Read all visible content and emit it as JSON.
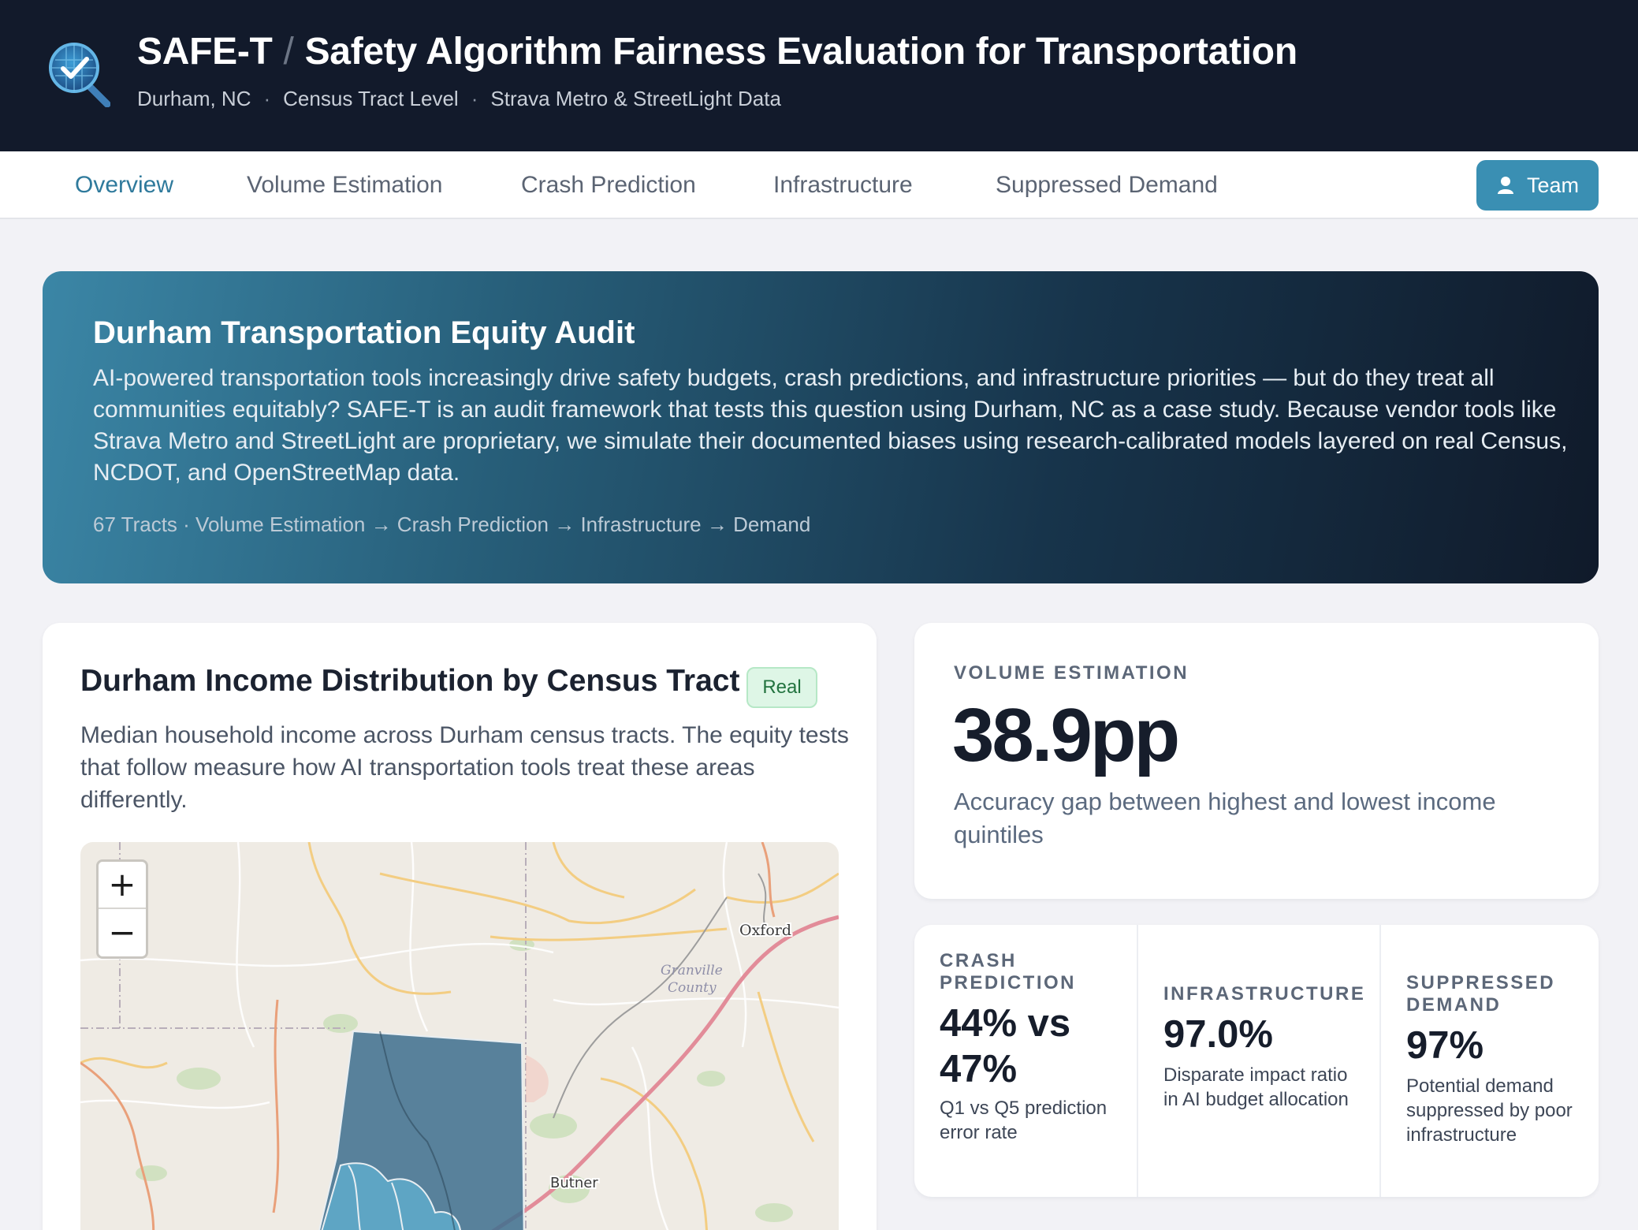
{
  "header": {
    "app_name": "SAFE-T",
    "separator": "/",
    "app_full_name": "Safety Algorithm Fairness Evaluation for Transportation",
    "location": "Durham, NC",
    "level": "Census Tract Level",
    "source": "Strava Metro & StreetLight Data",
    "dot": "·",
    "logo_icon": "magnifier-check-icon"
  },
  "nav": {
    "tabs": [
      {
        "label": "Overview",
        "active": true
      },
      {
        "label": "Volume Estimation",
        "active": false
      },
      {
        "label": "Crash Prediction",
        "active": false
      },
      {
        "label": "Infrastructure",
        "active": false
      },
      {
        "label": "Suppressed Demand",
        "active": false
      }
    ],
    "team_label": "Team",
    "team_icon": "person-icon"
  },
  "hero": {
    "title": "Durham Transportation Equity Audit",
    "text": "AI-powered transportation tools increasingly drive safety budgets, crash predictions, and infrastructure priorities — but do they treat all communities equitably? SAFE-T is an audit framework that tests this question using Durham, NC as a case study. Because vendor tools like Strava Metro and StreetLight are proprietary, we simulate their documented biases using research-calibrated models layered on real Census, NCDOT, and OpenStreetMap data.",
    "meta": "67 Tracts · Volume Estimation → Crash Prediction → Infrastructure → Demand"
  },
  "map_card": {
    "title": "Durham Income Distribution by Census Tract",
    "badge": "Real",
    "description": "Median household income across Durham census tracts. The equity tests that follow measure how AI transportation tools treat these areas differently.",
    "zoom_in": "+",
    "zoom_out": "−",
    "labels": {
      "oxford": "Oxford",
      "granville_1": "Granville",
      "granville_2": "County",
      "butner": "Butner"
    }
  },
  "volume": {
    "kicker": "Volume Estimation",
    "value": "38.9pp",
    "description": "Accuracy gap between highest and lowest income quintiles"
  },
  "metrics": [
    {
      "kicker": "Crash Prediction",
      "value": "44% vs 47%",
      "description": "Q1 vs Q5 prediction error rate"
    },
    {
      "kicker": "Infrastructure",
      "value": "97.0%",
      "description": "Disparate impact ratio in AI budget allocation"
    },
    {
      "kicker": "Suppressed Demand",
      "value": "97%",
      "description": "Potential demand suppressed by poor infrastructure"
    }
  ],
  "colors": {
    "header_bg": "#121a2b",
    "accent": "#3a8fb3",
    "active_tab": "#2f7a9c",
    "badge_bg": "#def6e6",
    "badge_text": "#22733f",
    "tract_fill": "#3d6f8e",
    "tract_light": "#5fa9c9"
  }
}
